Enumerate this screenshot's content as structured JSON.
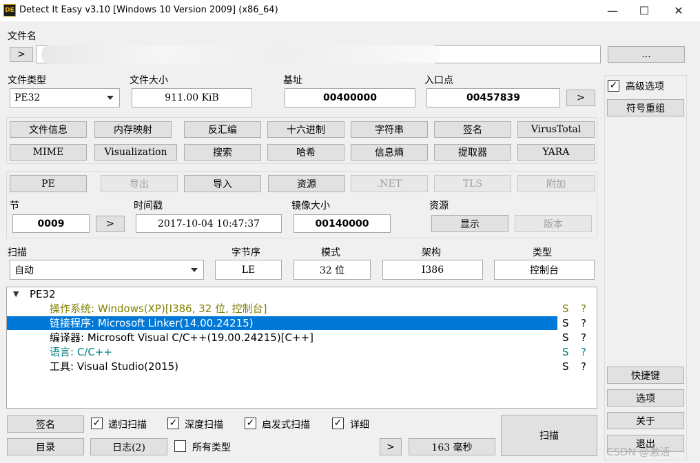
{
  "window": {
    "title": "Detect It Easy v3.10 [Windows 10 Version 2009] (x86_64)",
    "app_icon_text": "DE",
    "minimize": "—",
    "maximize": "☐",
    "close": "✕"
  },
  "file": {
    "label": "文件名",
    "open_btn": ">",
    "browse_btn": "..."
  },
  "info": {
    "filetype_label": "文件类型",
    "filetype_value": "PE32",
    "filesize_label": "文件大小",
    "filesize_value": "911.00 KiB",
    "base_label": "基址",
    "base_value": "00400000",
    "entry_label": "入口点",
    "entry_value": "00457839",
    "entry_btn": ">"
  },
  "tools_row1": [
    "文件信息",
    "内存映射",
    "反汇编",
    "十六进制",
    "字符串",
    "签名",
    "VirusTotal"
  ],
  "tools_row2": [
    "MIME",
    "Visualization",
    "搜索",
    "哈希",
    "信息熵",
    "提取器",
    "YARA"
  ],
  "pe_row": {
    "pe": "PE",
    "export": "导出",
    "import": "导入",
    "resources": "资源",
    "net": ".NET",
    "tls": "TLS",
    "overlay": "附加"
  },
  "pe_info": {
    "sections_label": "节",
    "sections_value": "0009",
    "sections_btn": ">",
    "timestamp_label": "时间戳",
    "timestamp_value": "2017-10-04 10:47:37",
    "imagesize_label": "镜像大小",
    "imagesize_value": "00140000",
    "res_label": "资源",
    "res_show": "显示",
    "res_version": "版本"
  },
  "scan": {
    "scan_label": "扫描",
    "scan_mode": "自动",
    "endian_label": "字节序",
    "endian_value": "LE",
    "mode_label": "模式",
    "mode_value": "32 位",
    "arch_label": "架构",
    "arch_value": "I386",
    "type_label": "类型",
    "type_value": "控制台"
  },
  "results": {
    "root": "PE32",
    "expander": "▼",
    "items": [
      {
        "text": "操作系统: Windows(XP)[I386, 32 位, 控制台]",
        "s": "S",
        "q": "?",
        "color": "#808000"
      },
      {
        "text": "链接程序: Microsoft Linker(14.00.24215)",
        "s": "S",
        "q": "?",
        "color": "#ffffff"
      },
      {
        "text": "编译器: Microsoft Visual C/C++(19.00.24215)[C++]",
        "s": "S",
        "q": "?",
        "color": "#000000"
      },
      {
        "text": "语言: C/C++",
        "s": "S",
        "q": "?",
        "color": "#008080"
      },
      {
        "text": "工具: Visual Studio(2015)",
        "s": "S",
        "q": "?",
        "color": "#000000"
      }
    ]
  },
  "bottom": {
    "signatures_btn": "签名",
    "recursive": "递归扫描",
    "deep": "深度扫描",
    "heuristic": "启发式扫描",
    "verbose": "详细",
    "directory_btn": "目录",
    "log_btn": "日志(2)",
    "all_types": "所有类型",
    "arrow_btn": ">",
    "time": "163 毫秒",
    "scan_btn": "扫描",
    "check_mark": "✓"
  },
  "right": {
    "advanced": "高级选项",
    "symbol_btn": "符号重组",
    "shortcuts_btn": "快捷键",
    "options_btn": "选项",
    "about_btn": "关于",
    "exit_btn": "退出"
  },
  "watermark": "CSDN @激活"
}
